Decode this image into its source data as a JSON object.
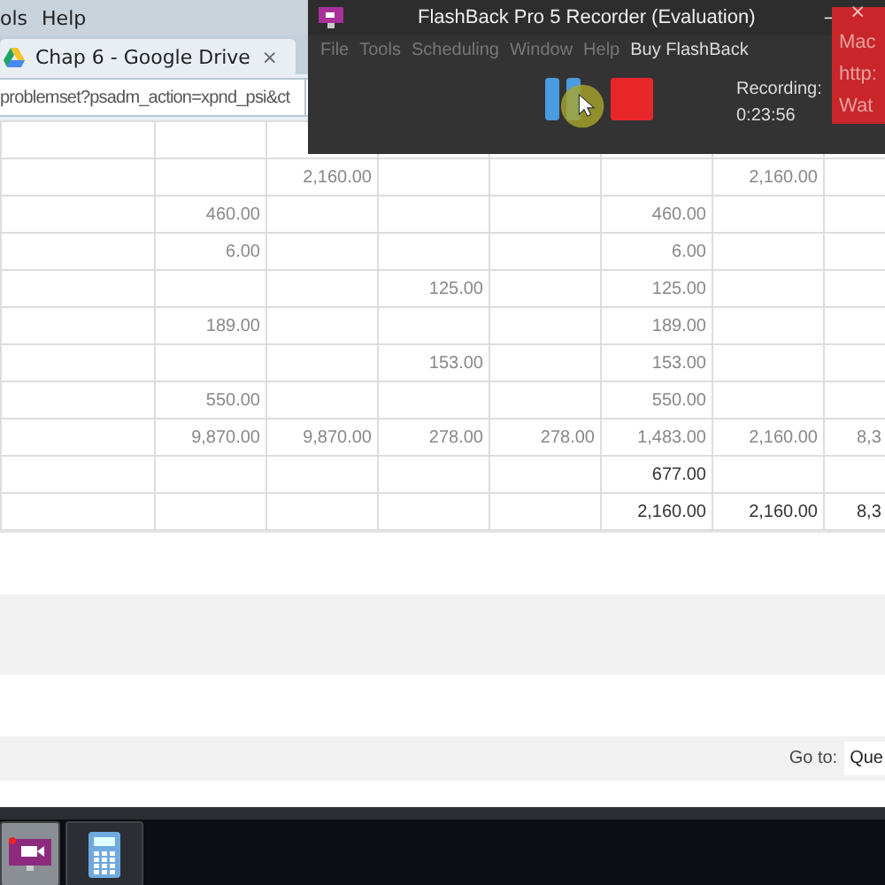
{
  "browser": {
    "menu": [
      "ols",
      "Help"
    ],
    "tabs": [
      {
        "label": "Chap 6 - Google Drive",
        "close": "×",
        "selected": true
      }
    ],
    "address": "problemset?psadm_action=xpnd_psi&ct"
  },
  "table": {
    "rows": [
      {
        "cells": [
          "",
          "",
          "2,160.00",
          "",
          "",
          "",
          "2,160.00",
          ""
        ],
        "emphasis": false
      },
      {
        "cells": [
          "",
          "460.00",
          "",
          "",
          "",
          "460.00",
          "",
          ""
        ],
        "emphasis": false
      },
      {
        "cells": [
          "",
          "6.00",
          "",
          "",
          "",
          "6.00",
          "",
          ""
        ],
        "emphasis": false
      },
      {
        "cells": [
          "",
          "",
          "",
          "125.00",
          "",
          "125.00",
          "",
          ""
        ],
        "emphasis": false
      },
      {
        "cells": [
          "",
          "189.00",
          "",
          "",
          "",
          "189.00",
          "",
          ""
        ],
        "emphasis": false
      },
      {
        "cells": [
          "",
          "",
          "",
          "153.00",
          "",
          "153.00",
          "",
          ""
        ],
        "emphasis": false
      },
      {
        "cells": [
          "",
          "550.00",
          "",
          "",
          "",
          "550.00",
          "",
          ""
        ],
        "emphasis": false
      },
      {
        "cells": [
          "",
          "9,870.00",
          "9,870.00",
          "278.00",
          "278.00",
          "1,483.00",
          "2,160.00",
          "8,3"
        ],
        "emphasis": false
      },
      {
        "cells": [
          "",
          "",
          "",
          "",
          "",
          "677.00",
          "",
          ""
        ],
        "emphasis": true
      },
      {
        "cells": [
          "",
          "",
          "",
          "",
          "",
          "2,160.00",
          "2,160.00",
          "8,3"
        ],
        "emphasis": true
      }
    ]
  },
  "footer": {
    "goto_label": "Go to:",
    "goto_value": "Que"
  },
  "recorder": {
    "title": "FlashBack Pro 5 Recorder (Evaluation)",
    "minimize": "–",
    "close": "×",
    "menu": [
      {
        "label": "File",
        "highlight": false
      },
      {
        "label": "Tools",
        "highlight": false
      },
      {
        "label": "Scheduling",
        "highlight": false
      },
      {
        "label": "Window",
        "highlight": false
      },
      {
        "label": "Help",
        "highlight": false
      },
      {
        "label": "Buy FlashBack",
        "highlight": true
      }
    ],
    "status_label": "Recording:",
    "elapsed": "0:23:56"
  },
  "red_panel": {
    "lines": [
      "Mac",
      "http:",
      "Wat"
    ]
  },
  "taskbar": {
    "items": [
      {
        "kind": "recorder",
        "selected": true
      },
      {
        "kind": "calculator",
        "selected": false
      }
    ]
  }
}
